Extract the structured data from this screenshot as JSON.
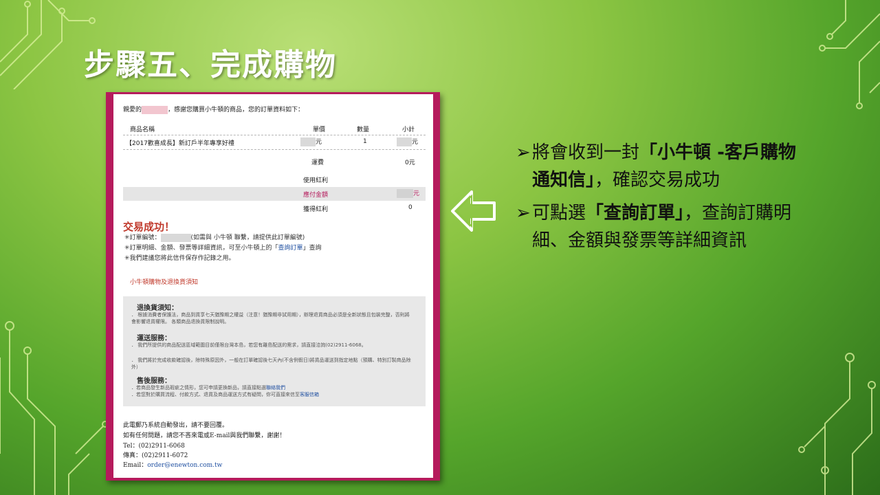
{
  "slide": {
    "title": "步驟五、完成購物",
    "bullets": [
      {
        "marker": "➢",
        "pre": "將會收到一封",
        "bold": "「小牛頓 -客戶購物通知信」",
        "post": "，確認交易成功"
      },
      {
        "marker": "➢",
        "pre": "可點選",
        "bold": "「查詢訂單」",
        "post": "，查詢訂購明細、金額與發票等詳細資訊"
      }
    ]
  },
  "email": {
    "greeting_pre": "親愛的",
    "greeting_post": "，感謝您購買小牛頓的商品，您的訂單資料如下：",
    "table": {
      "headers": [
        "商品名稱",
        "單價",
        "數量",
        "小計"
      ],
      "item": {
        "name": "【2017歡喜成長】新訂戶半年專享好禮",
        "price_unit": "元",
        "qty": "1",
        "subtotal_unit": "元"
      },
      "shipping_label": "運費",
      "shipping_value": "0元",
      "bonus_used_label": "使用紅利",
      "amount_due_label": "應付金額",
      "amount_due_unit": "元",
      "bonus_earned_label": "獲得紅利",
      "bonus_earned_value": "0"
    },
    "success_title": "交易成功！",
    "notes": {
      "order_no_pre": "✳訂單編號：",
      "order_no_post": "(如需與 小牛頓 聯繫，請提供此訂單編號)",
      "detail_pre": "✳訂單明細、金額、發票等詳細資訊，可至小牛頓上的「",
      "detail_link": "查詢訂單",
      "detail_post": "」查詢",
      "keep": "✳我們建議您將此信件保存作記錄之用。"
    },
    "policy_link": "小牛頓購物及退換貨須知",
    "policy": {
      "return_head": "退換貨須知：",
      "return_text": "． 根據消費者保護法，商品到貨享七天猶豫期之權益（注意！猶豫期非試用期），辦理退貨商品必須是全新狀態且包裝完整，否則將會影響退貨權限。 各類商品退換貨限制說明。",
      "ship_head": "運送服務：",
      "ship_text_1": "． 我們所提供的商品配送區域範圍目前僅限台灣本島，若您有離島配送的需求，請直接洽詢(02)2911-6068。",
      "ship_text_2": "． 我們將於完成收款確認後，除特殊原因外，一般在訂單確認後七天內(不含例假日)將貨品運送到指定地點（預購、特別訂製商品除外）",
      "after_head": "售後服務：",
      "after_text_1": "．若商品發生新品瑕疵之情形，您可申請更換新品，請直接點選",
      "after_link_1": "聯絡我們",
      "after_text_2": "．若您對於購買流程、付款方式、退貨及商品運送方式有疑問，你可直接來信至",
      "after_link_2": "客服信箱"
    },
    "footer": {
      "auto": "此電郵乃系統自動發出，請不要回覆。",
      "contact": "如有任何問題，請您不吝來電或E-mail與我們聯繫，謝謝！",
      "tel": "Tel：(02)2911-6068",
      "fax": "傳真：(02)2911-6072",
      "email_label": "Email：",
      "email_addr": "order@enewton.com.tw"
    }
  },
  "colors": {
    "frame": "#b51b5c",
    "success": "#c0392b",
    "link": "#1f4fa0",
    "circuit": "#d9f09a"
  },
  "icons": [
    "left-arrow-icon",
    "circuit-decoration"
  ]
}
